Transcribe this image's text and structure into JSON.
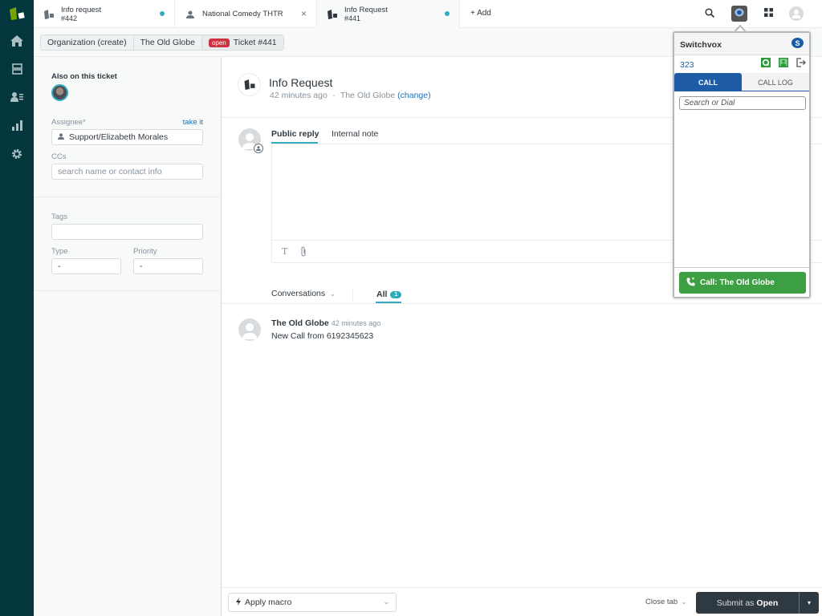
{
  "nav": {
    "items": [
      "home",
      "views",
      "customers",
      "reporting",
      "admin"
    ]
  },
  "tabs": [
    {
      "title": "Info request",
      "subtitle": "#442",
      "icon": "ticket-icon",
      "unread": true,
      "active": false
    },
    {
      "title": "National Comedy THTR",
      "subtitle": "",
      "icon": "user-icon",
      "closable": true,
      "active": false
    },
    {
      "title": "Info Request",
      "subtitle": "#441",
      "icon": "ticket-icon",
      "unread": true,
      "active": true
    }
  ],
  "add_tab_label": "+ Add",
  "top_icons": [
    "search-icon",
    "switchvox-icon",
    "apps-grid-icon",
    "profile-avatar"
  ],
  "breadcrumb": {
    "items": [
      "Organization (create)",
      "The Old Globe"
    ],
    "status_badge": "open",
    "ticket": "Ticket #441"
  },
  "left_panel": {
    "also_on_ticket": "Also on this ticket",
    "assignee_label": "Assignee*",
    "take_it": "take it",
    "assignee_value": "Support/Elizabeth Morales",
    "ccs_label": "CCs",
    "ccs_placeholder": "search name or contact info",
    "tags_label": "Tags",
    "tags_value": "",
    "type_label": "Type",
    "type_value": "-",
    "priority_label": "Priority",
    "priority_value": "-"
  },
  "ticket": {
    "title": "Info Request",
    "time_ago": "42 minutes ago",
    "separator": "•",
    "organization": "The Old Globe",
    "change_link": "(change)"
  },
  "reply": {
    "tabs": [
      "Public reply",
      "Internal note"
    ],
    "active_tab": "Public reply",
    "toolbar": [
      "text-format-icon",
      "attachment-icon"
    ]
  },
  "conversations": {
    "filter_label": "Conversations",
    "all_label": "All",
    "all_count": "1",
    "messages": [
      {
        "author": "The Old Globe",
        "time": "42 minutes ago",
        "body": "New Call from 6192345623"
      }
    ]
  },
  "footer": {
    "macro_label": "Apply macro",
    "close_tab": "Close tab",
    "submit_prefix": "Submit as",
    "submit_status": "Open"
  },
  "switchvox": {
    "title": "Switchvox",
    "extension": "323",
    "tabs": [
      "CALL",
      "CALL LOG"
    ],
    "active_tab": "CALL",
    "search_placeholder": "Search or Dial",
    "call_button": "Call: The Old Globe",
    "colors": {
      "primary": "#1f5ca8",
      "call_green": "#3d9f43"
    }
  },
  "colors": {
    "nav_bg": "#03363d",
    "accent": "#30aabc",
    "open_badge": "#cc3340",
    "link": "#1f73b7"
  }
}
